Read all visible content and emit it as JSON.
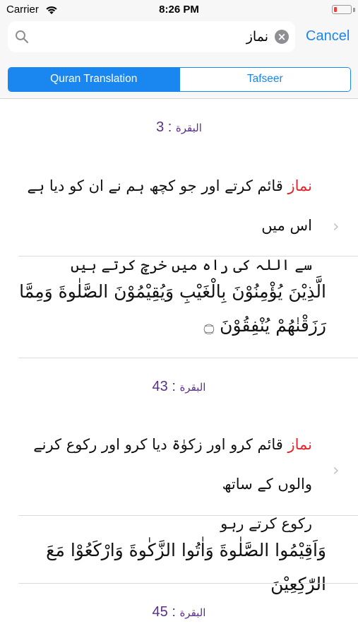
{
  "status_bar": {
    "carrier": "Carrier",
    "time": "8:26 PM",
    "battery_color": "#ff3b30"
  },
  "search": {
    "query": "نماز",
    "icon": "magnifier-icon",
    "clear_icon": "clear-circle-icon",
    "cancel_label": "Cancel"
  },
  "segments": [
    {
      "label": "Quran Translation",
      "selected": true
    },
    {
      "label": "Tafseer",
      "selected": false
    }
  ],
  "accent_color": "#1a86f0",
  "reference_color": "#5a2e8f",
  "highlight_color": "#e0262c",
  "results": [
    {
      "surah": "البقرة",
      "separator": " : ",
      "verse": "3",
      "highlight": "نماز",
      "translation_line1_rest": " قائم کرتے اور جو کچھ ہم نے ان کو دیا ہے اس میں",
      "translation_line2": "سے اللہ کی راہ میں خرچ کرتے ہیں",
      "arabic": "الَّذِيْنَ يُؤْمِنُوْنَ بِالْغَيْبِ وَيُقِيْمُوْنَ الصَّلٰوةَ وَمِمَّا رَزَقْنٰھُمْ يُنْفِقُوْنَ ۝"
    },
    {
      "surah": "البقرة",
      "separator": " : ",
      "verse": "43",
      "highlight": "نماز",
      "translation_line1_rest": " قائم کرو اور زکوٰۃ دیا کرو اور رکوع کرنے والوں کے ساتھ",
      "translation_line2": "رکوع کرتے رہو",
      "arabic": "وَاَقِيْمُوا الصَّلٰوةَ وَاٰتُوا الزَّكٰوةَ وَارْكَعُوْا مَعَ الرّٰكِعِيْنَ"
    },
    {
      "surah": "البقرة",
      "separator": " : ",
      "verse": "45"
    }
  ]
}
